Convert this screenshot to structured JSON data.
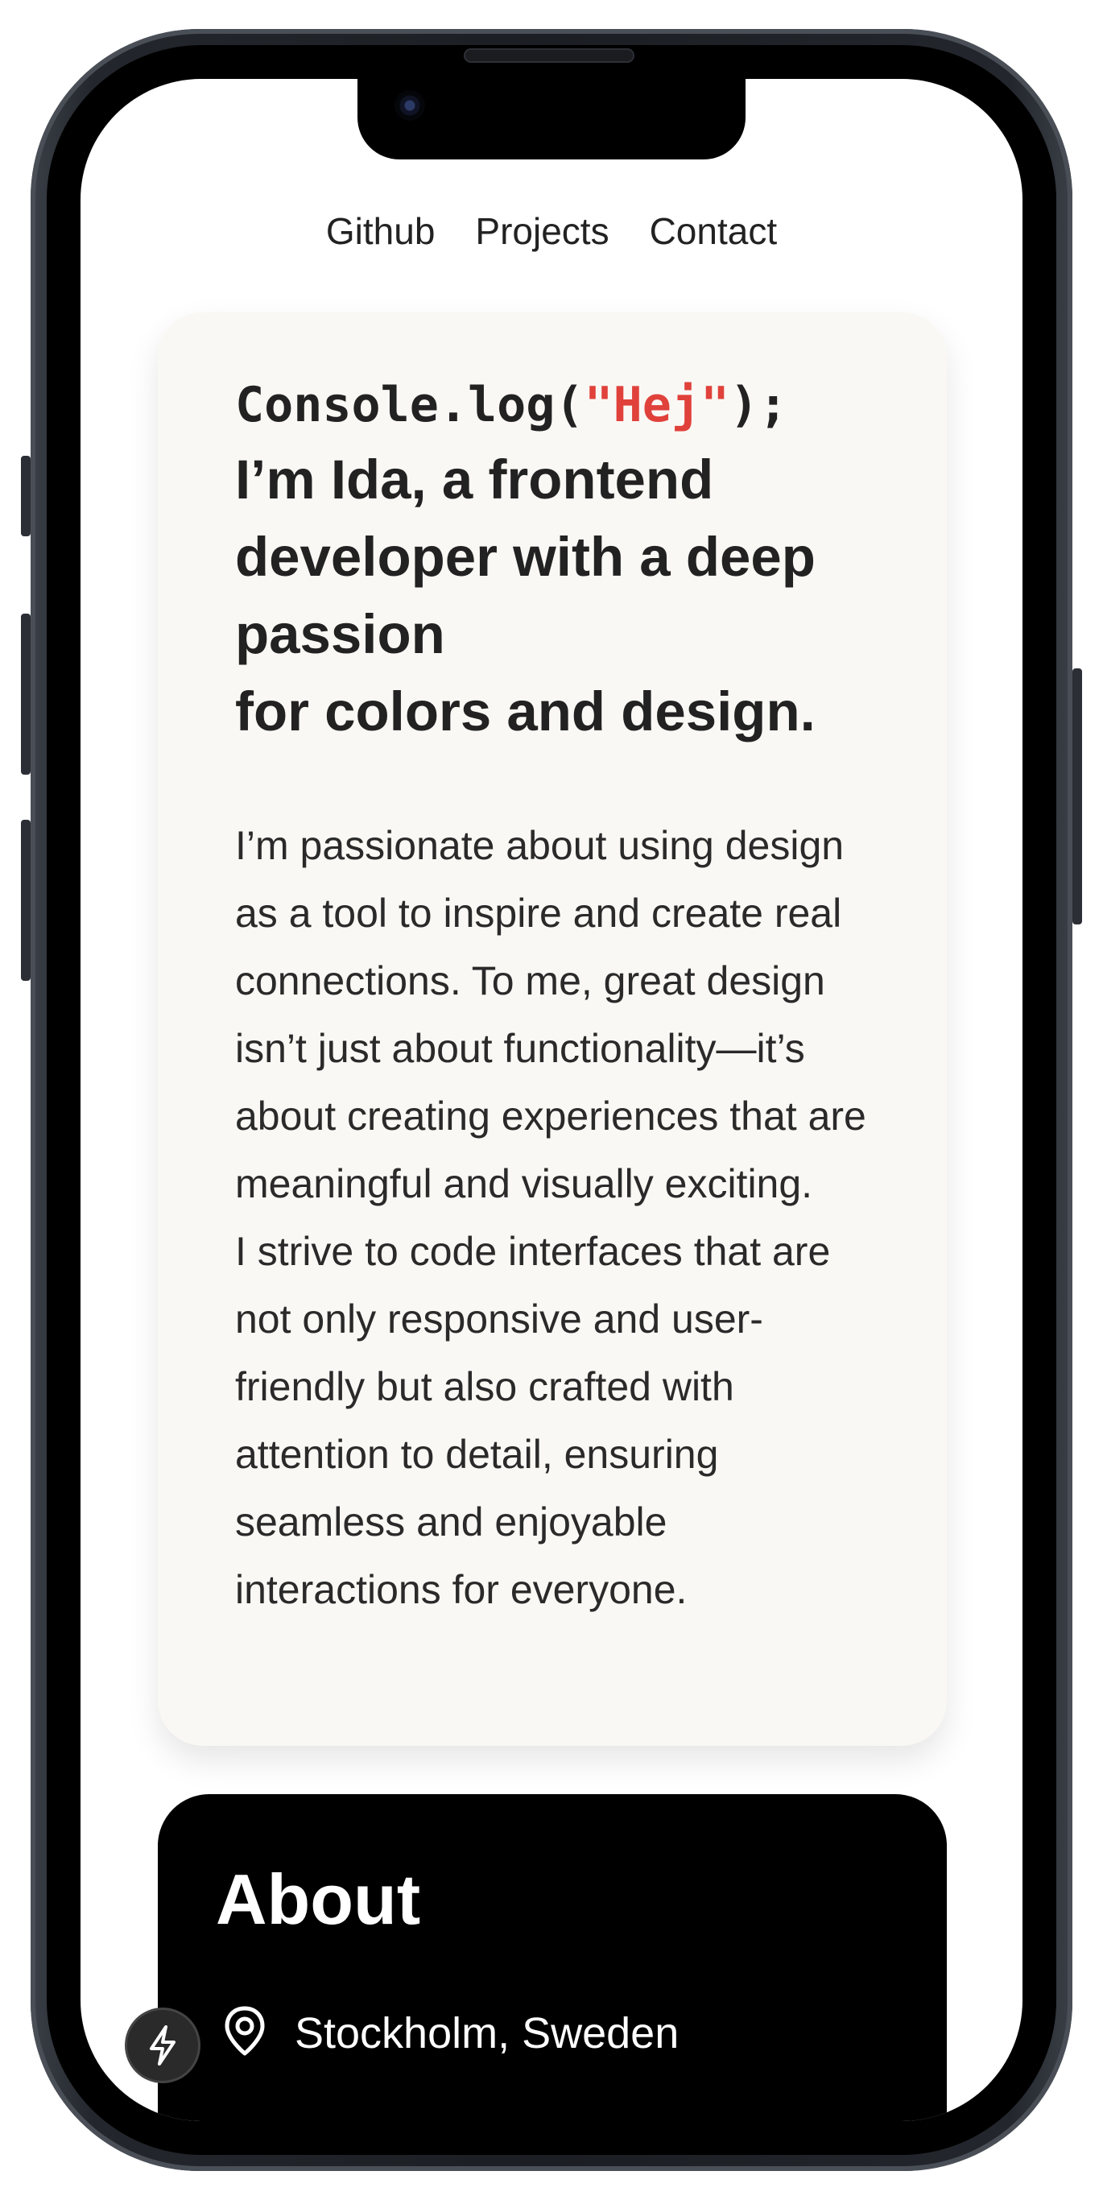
{
  "nav": {
    "items": [
      "Github",
      "Projects",
      "Contact"
    ]
  },
  "intro": {
    "console_prefix": "Console.log(",
    "console_string": "\"Hej\"",
    "console_suffix": ");",
    "headline_1": "I’m Ida, a frontend developer with a deep passion",
    "headline_2": "for colors and design.",
    "paragraph_1": "I’m passionate about using design as a tool to inspire and create real connections. To me, great design isn’t just about functionality—it’s about creating experiences that are meaningful and visually exciting.",
    "paragraph_2": "I strive to code interfaces that are not only responsive and user-friendly but also crafted with attention to detail, ensuring seamless and enjoyable interactions for everyone."
  },
  "about": {
    "title": "About",
    "location": "Stockholm, Sweden",
    "location_icon": "map-pin-icon"
  },
  "fab": {
    "icon": "lightning-bolt-icon"
  },
  "colors": {
    "accent_string": "#e0413b",
    "card_background": "#faf8f4",
    "about_background": "#000000"
  }
}
